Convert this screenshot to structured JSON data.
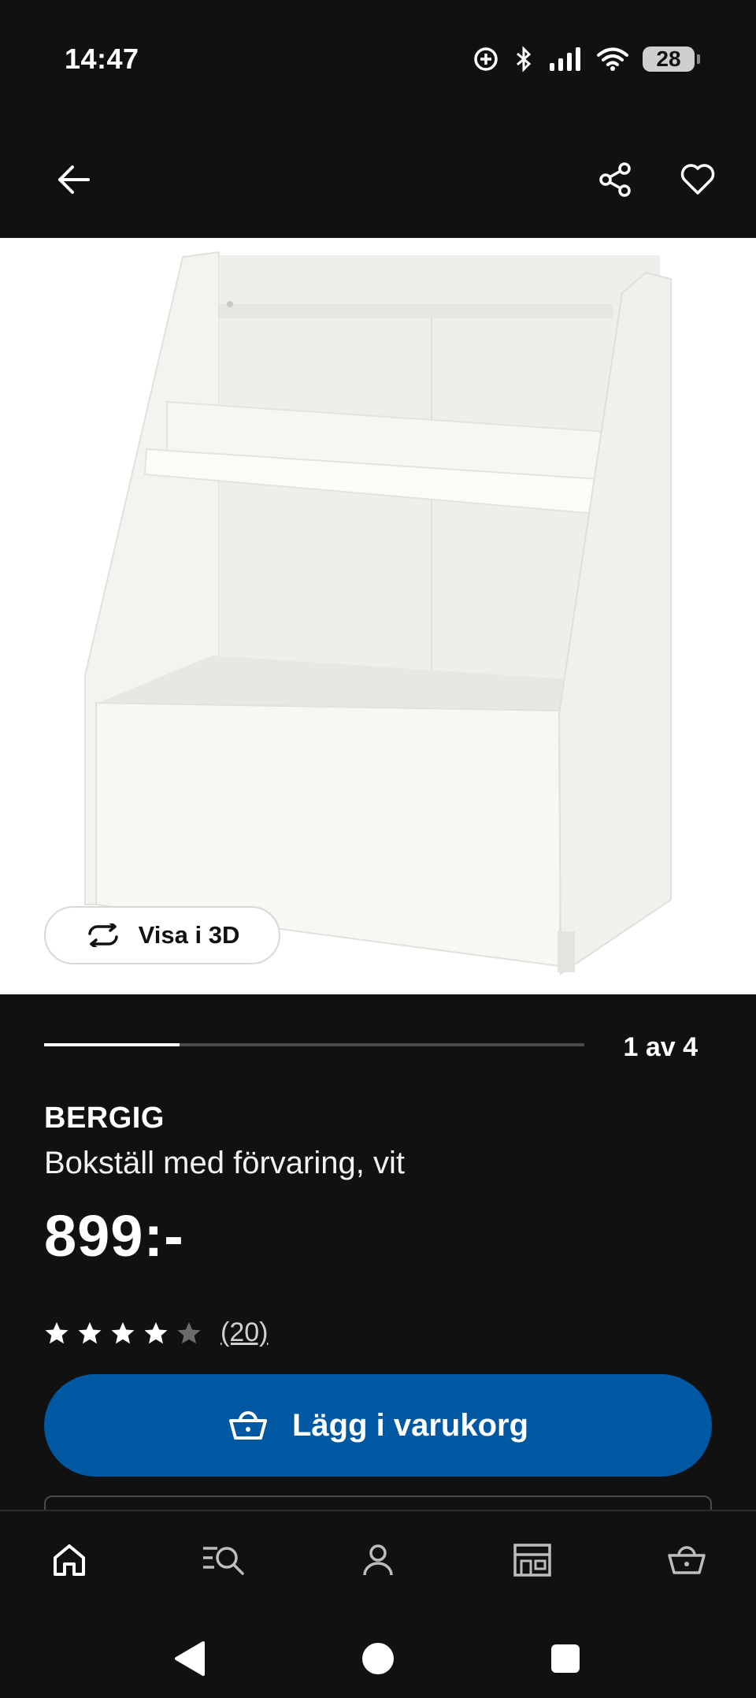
{
  "status_bar": {
    "time": "14:47",
    "battery_level": "28",
    "icons": [
      "data-saver-icon",
      "bluetooth-icon",
      "signal-icon",
      "wifi-icon",
      "battery-icon"
    ]
  },
  "top_bar": {
    "icons": [
      "back-arrow-icon",
      "share-icon",
      "heart-icon"
    ]
  },
  "hero": {
    "view_3d_label": "Visa i 3D",
    "view_3d_icon": "rotate-icon"
  },
  "gallery": {
    "position_label": "1 av 4",
    "current": 1,
    "total": 4
  },
  "product": {
    "brand": "BERGIG",
    "description": "Bokställ med förvaring, vit",
    "price": "899:-",
    "rating": 4,
    "rating_max": 5,
    "review_count": "(20)"
  },
  "actions": {
    "add_to_cart_label": "Lägg i varukorg",
    "add_to_cart_icon": "basket-icon"
  },
  "bottom_nav": {
    "items": [
      "home-icon",
      "search-list-icon",
      "profile-icon",
      "store-icon",
      "cart-icon"
    ]
  },
  "colors": {
    "background": "#111111",
    "accent_blue": "#0058a3",
    "text": "#ffffff"
  }
}
